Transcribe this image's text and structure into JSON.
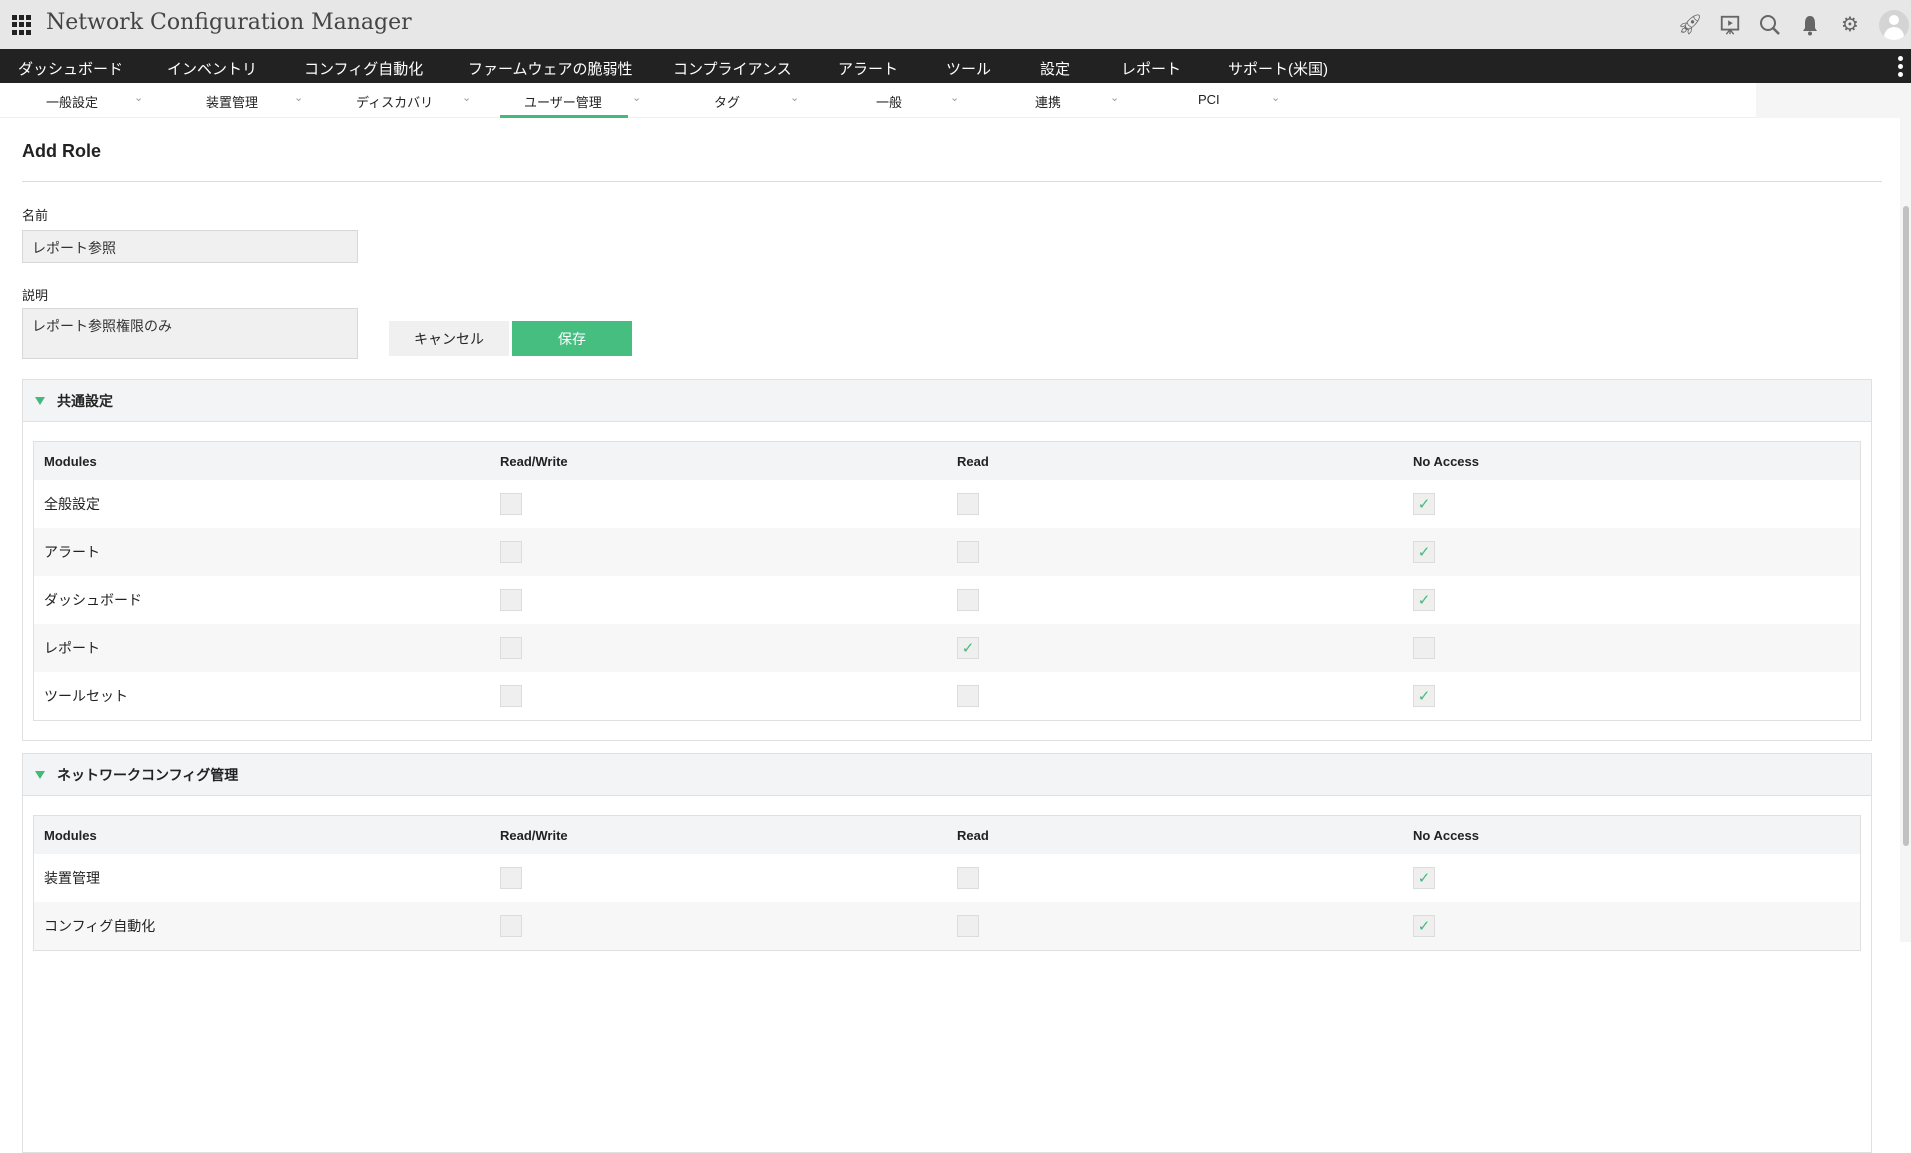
{
  "header": {
    "title": "Network Configuration Manager",
    "icons": [
      "rocket-icon",
      "presentation-icon",
      "search-icon",
      "bell-icon",
      "gear-icon",
      "avatar"
    ]
  },
  "main_nav": [
    "ダッシュボード",
    "インベントリ",
    "コンフィグ自動化",
    "ファームウェアの脆弱性",
    "コンプライアンス",
    "アラート",
    "ツール",
    "設定",
    "レポート",
    "サポート(米国)"
  ],
  "sub_nav": [
    {
      "label": "一般設定"
    },
    {
      "label": "装置管理"
    },
    {
      "label": "ディスカバリ"
    },
    {
      "label": "ユーザー管理",
      "active": true
    },
    {
      "label": "タグ"
    },
    {
      "label": "一般"
    },
    {
      "label": "連携"
    },
    {
      "label": "PCI"
    }
  ],
  "chevron": "⌄",
  "form": {
    "title": "Add Role",
    "name_label": "名前",
    "name_value": "レポート参照",
    "desc_label": "説明",
    "desc_value": "レポート参照権限のみ",
    "cancel": "キャンセル",
    "save": "保存"
  },
  "columns": [
    "Modules",
    "Read/Write",
    "Read",
    "No Access"
  ],
  "check": "✓",
  "sections": [
    {
      "title": "共通設定",
      "rows": [
        {
          "module": "全般設定",
          "access": "No Access"
        },
        {
          "module": "アラート",
          "access": "No Access"
        },
        {
          "module": "ダッシュボード",
          "access": "No Access"
        },
        {
          "module": "レポート",
          "access": "Read"
        },
        {
          "module": "ツールセット",
          "access": "No Access"
        }
      ]
    },
    {
      "title": "ネットワークコンフィグ管理",
      "rows": [
        {
          "module": "装置管理",
          "access": "No Access"
        },
        {
          "module": "コンフィグ自動化",
          "access": "No Access"
        }
      ]
    }
  ],
  "colors": {
    "accent": "#45be80",
    "nav_bg": "#222222"
  }
}
